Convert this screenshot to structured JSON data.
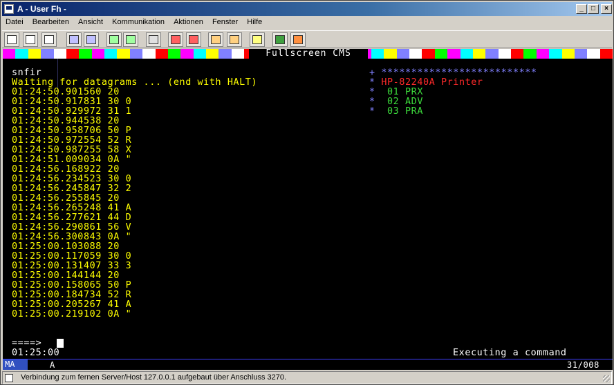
{
  "window": {
    "title": "A - User Fh -"
  },
  "menu": [
    "Datei",
    "Bearbeiten",
    "Ansicht",
    "Kommunikation",
    "Aktionen",
    "Fenster",
    "Hilfe"
  ],
  "toolbar_icons": [
    "connect-icon",
    "copy-icon",
    "paste-icon",
    "send-icon",
    "receive-icon",
    "screen-icon",
    "terminal-icon",
    "printer-icon",
    "record-icon",
    "play-icon",
    "macro-run-icon",
    "macro-stop-icon",
    "clipboard-icon",
    "globe-icon",
    "key-icon"
  ],
  "colorbar": {
    "title": "Fullscreen CMS",
    "colors": [
      "#ff00ff",
      "#00ffff",
      "#ffff00",
      "#8080ff",
      "#ffffff",
      "#ff0000",
      "#00ff00",
      "#ff00ff",
      "#00ffff",
      "#ffff00",
      "#8080ff",
      "#ffffff",
      "#ff0000",
      "#00ff00",
      "#ff00ff",
      "#00ffff",
      "#ffff00",
      "#8080ff",
      "#ffffff",
      "#ff0000",
      "#00ff00",
      "#ff00ff",
      "#00ffff",
      "#ffff00",
      "#8080ff",
      "#ffffff",
      "#ff0000",
      "#00ff00",
      "#ff00ff",
      "#00ffff",
      "#ffff00",
      "#8080ff",
      "#ffffff",
      "#ff0000",
      "#00ff00",
      "#ff00ff",
      "#00ffff",
      "#ffff00",
      "#8080ff",
      "#ffffff",
      "#ff0000",
      "#00ff00",
      "#ff00ff",
      "#00ffff",
      "#ffff00",
      "#8080ff",
      "#ffffff",
      "#ff0000"
    ]
  },
  "terminal": {
    "command": "snfir",
    "waiting": "Waiting for datagrams ... (end with HALT)",
    "log": [
      "01:24:50.901560 20",
      "01:24:50.917831 30 0",
      "01:24:50.929972 31 1",
      "01:24:50.944538 20",
      "01:24:50.958706 50 P",
      "01:24:50.972554 52 R",
      "01:24:50.987255 58 X",
      "01:24:51.009034 0A \"",
      "01:24:56.168922 20",
      "01:24:56.234523 30 0",
      "01:24:56.245847 32 2",
      "01:24:56.255845 20",
      "01:24:56.265248 41 A",
      "01:24:56.277621 44 D",
      "01:24:56.290861 56 V",
      "01:24:56.300843 0A \"",
      "01:25:00.103088 20",
      "01:25:00.117059 30 0",
      "01:25:00.131407 33 3",
      "01:25:00.144144 20",
      "01:25:00.158065 50 P",
      "01:25:00.184734 52 R",
      "01:25:00.205267 41 A",
      "01:25:00.219102 0A \""
    ],
    "panel": {
      "header_prefix": "+",
      "header_stars": "**************************",
      "title_prefix": "*",
      "title": "HP-82240A Printer",
      "items": [
        {
          "prefix": "*",
          "text": " 01 PRX"
        },
        {
          "prefix": "*",
          "text": " 02 ADV"
        },
        {
          "prefix": "*",
          "text": " 03 PRA"
        }
      ]
    },
    "prompt": "====>",
    "time": "01:25:00",
    "state": "Executing a command"
  },
  "oia": {
    "mode": "MA",
    "indicator": "A",
    "cursor_pos": "31/008"
  },
  "statusbar": {
    "text": "Verbindung zum fernen Server/Host 127.0.0.1 aufgebaut über Anschluss 3270."
  }
}
